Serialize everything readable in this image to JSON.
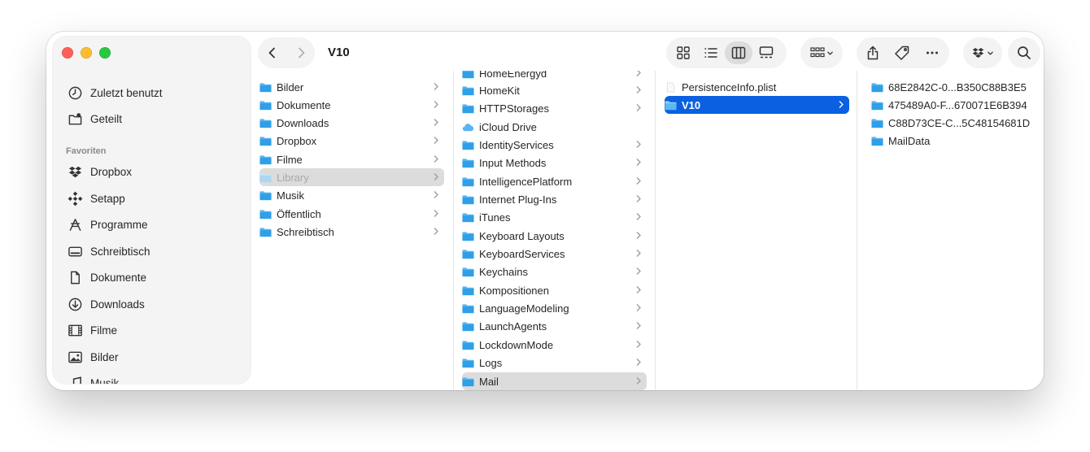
{
  "window": {
    "title": "V10"
  },
  "sidebar": {
    "items": [
      {
        "label": "Zuletzt benutzt",
        "icon": "clock-icon"
      },
      {
        "label": "Geteilt",
        "icon": "shared-folder-icon"
      }
    ],
    "favorites_heading": "Favoriten",
    "favorites": [
      {
        "label": "Dropbox",
        "icon": "dropbox-icon"
      },
      {
        "label": "Setapp",
        "icon": "setapp-icon"
      },
      {
        "label": "Programme",
        "icon": "applications-icon"
      },
      {
        "label": "Schreibtisch",
        "icon": "desktop-icon"
      },
      {
        "label": "Dokumente",
        "icon": "document-icon"
      },
      {
        "label": "Downloads",
        "icon": "download-icon"
      },
      {
        "label": "Filme",
        "icon": "film-icon"
      },
      {
        "label": "Bilder",
        "icon": "photo-icon"
      },
      {
        "label": "Musik",
        "icon": "music-icon"
      }
    ]
  },
  "columns": {
    "col1": [
      {
        "label": "Bilder"
      },
      {
        "label": "Dokumente"
      },
      {
        "label": "Downloads"
      },
      {
        "label": "Dropbox"
      },
      {
        "label": "Filme"
      },
      {
        "label": "Library",
        "state": "selected-gray"
      },
      {
        "label": "Musik"
      },
      {
        "label": "Öffentlich"
      },
      {
        "label": "Schreibtisch"
      }
    ],
    "col2": [
      {
        "label": "HomeEnergyd"
      },
      {
        "label": "HomeKit"
      },
      {
        "label": "HTTPStorages"
      },
      {
        "label": "iCloud Drive",
        "icon": "cloud"
      },
      {
        "label": "IdentityServices"
      },
      {
        "label": "Input Methods"
      },
      {
        "label": "IntelligencePlatform"
      },
      {
        "label": "Internet Plug-Ins"
      },
      {
        "label": "iTunes"
      },
      {
        "label": "Keyboard Layouts"
      },
      {
        "label": "KeyboardServices"
      },
      {
        "label": "Keychains"
      },
      {
        "label": "Kompositionen"
      },
      {
        "label": "LanguageModeling"
      },
      {
        "label": "LaunchAgents"
      },
      {
        "label": "LockdownMode"
      },
      {
        "label": "Logs"
      },
      {
        "label": "Mail",
        "state": "selected-gray"
      }
    ],
    "col3": [
      {
        "label": "PersistenceInfo.plist",
        "icon": "file"
      },
      {
        "label": "V10",
        "state": "selected-blue"
      }
    ],
    "col4": [
      {
        "label": "68E2842C-0...B350C88B3E5"
      },
      {
        "label": "475489A0-F...670071E6B394"
      },
      {
        "label": "C88D73CE-C...5C48154681D"
      },
      {
        "label": "MailData"
      }
    ]
  },
  "colors": {
    "selection_blue": "#0a60e0",
    "selection_gray": "#dcdcdc",
    "folder_blue": "#5ab4f0",
    "close": "#ff5f57",
    "minimize": "#febc2e",
    "maximize": "#28c840"
  }
}
